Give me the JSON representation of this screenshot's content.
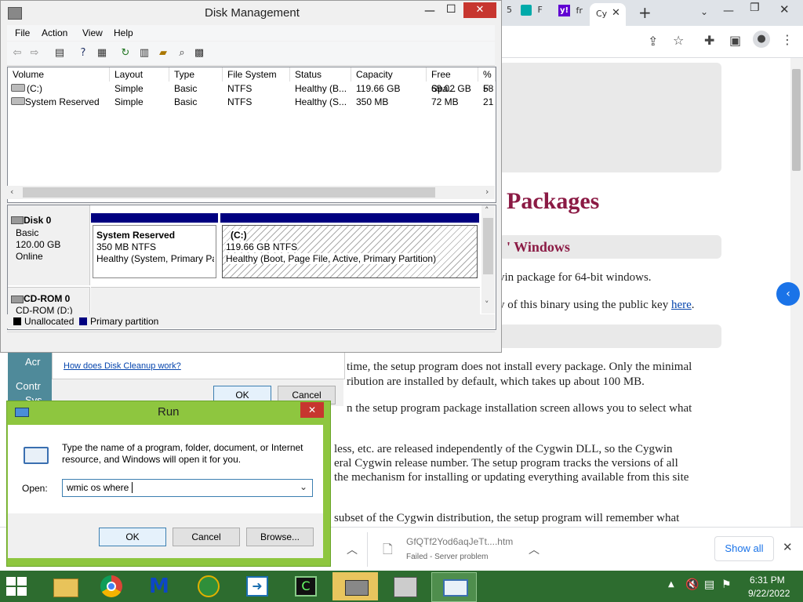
{
  "browser": {
    "tabs": [
      {
        "label": "5"
      },
      {
        "label": "F"
      },
      {
        "label": "fr"
      },
      {
        "label": "Cy"
      }
    ],
    "new_tab": "+",
    "content": {
      "title": "Packages",
      "subtitle": "' Windows",
      "lines": [
        {
          "text": "vin package for 64-bit windows."
        },
        {
          "text_before": "y of this binary using the public key ",
          "link": "here",
          "text_after": "."
        },
        {
          "text": "time, the setup program does not install every package. Only the minimal"
        },
        {
          "text": "ribution are installed by default, which takes up about 100 MB."
        },
        {
          "text": "n the setup program package installation screen allows you to select what"
        },
        {
          "text": "less, etc. are released independently of the Cygwin DLL, so the Cygwin"
        },
        {
          "text": "eral Cygwin release number. The setup program tracks the versions of all"
        },
        {
          "text": "the mechanism for installing or updating everything available from this site"
        },
        {
          "text": "subset of the Cygwin distribution, the setup program will remember what"
        }
      ]
    },
    "download": {
      "filename": "GfQTf2Yod6aqJeTt....htm",
      "status": "Failed - Server problem",
      "show_all": "Show all"
    }
  },
  "disk_management": {
    "title": "Disk Management",
    "menu": [
      "File",
      "Action",
      "View",
      "Help"
    ],
    "columns": [
      "Volume",
      "Layout",
      "Type",
      "File System",
      "Status",
      "Capacity",
      "Free Spa...",
      "% F"
    ],
    "rows": [
      [
        "(C:)",
        "Simple",
        "Basic",
        "NTFS",
        "Healthy (B...",
        "119.66 GB",
        "69.02 GB",
        "58"
      ],
      [
        "System Reserved",
        "Simple",
        "Basic",
        "NTFS",
        "Healthy (S...",
        "350 MB",
        "72 MB",
        "21"
      ]
    ],
    "disks": [
      {
        "name": "Disk 0",
        "type": "Basic",
        "size": "120.00 GB",
        "state": "Online"
      },
      {
        "name": "CD-ROM 0",
        "type": "CD-ROM (D:)"
      }
    ],
    "partitions": [
      {
        "name": "System Reserved",
        "size": "350 MB NTFS",
        "status": "Healthy (System, Primary Pa"
      },
      {
        "name": "(C:)",
        "size": "119.66 GB NTFS",
        "status": "Healthy (Boot, Page File, Active, Primary Partition)"
      }
    ],
    "legend": [
      "Unallocated",
      "Primary partition"
    ]
  },
  "cleanup": {
    "side_labels": [
      "Acr",
      "Contr",
      "Sys"
    ],
    "link": "How does Disk Cleanup work?",
    "ok": "OK",
    "cancel": "Cancel"
  },
  "run": {
    "title": "Run",
    "description": "Type the name of a program, folder, document, or Internet resource, and Windows will open it for you.",
    "open_label": "Open:",
    "open_value": "wmic os where",
    "ok": "OK",
    "cancel": "Cancel",
    "browse": "Browse..."
  },
  "taskbar": {
    "time": "6:31 PM",
    "date": "9/22/2022"
  },
  "colors": {
    "run_frame": "#8ec63f",
    "close_red": "#c7362f",
    "partition_blue": "#000080",
    "taskbar": "#2d6c2f",
    "page_heading": "#8b1a44"
  }
}
